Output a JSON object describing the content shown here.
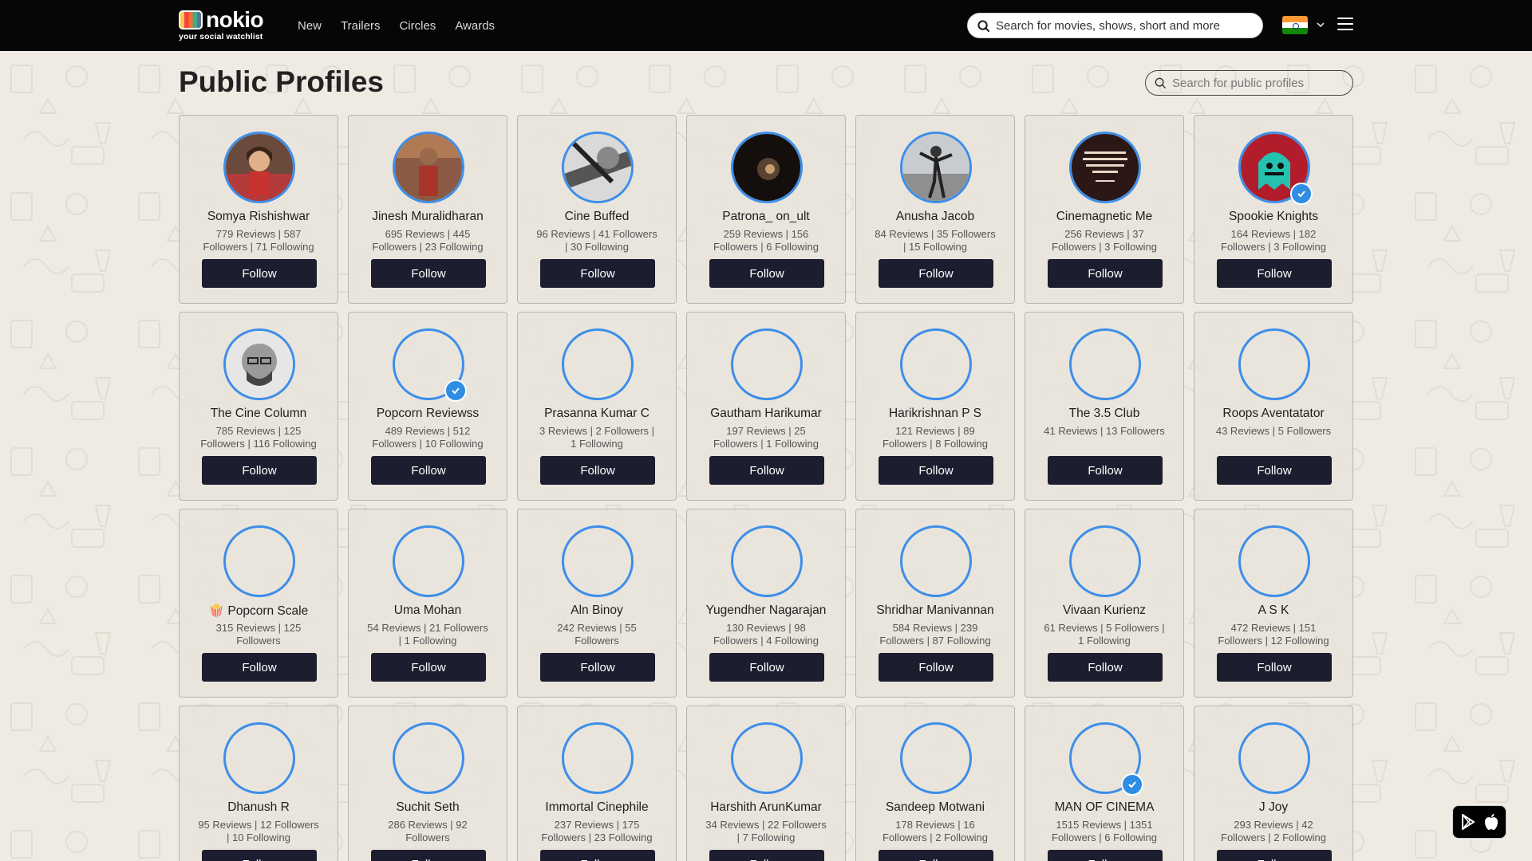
{
  "nav": {
    "logo_word": "nokio",
    "logo_tagline": "your social watchlist",
    "links": [
      "New",
      "Trailers",
      "Circles",
      "Awards"
    ],
    "search_placeholder": "Search for movies, shows, short and more"
  },
  "page": {
    "title": "Public Profiles",
    "search_placeholder": "Search for public profiles",
    "follow_label": "Follow"
  },
  "colors": {
    "nav_bg": "#060606",
    "page_bg": "#efebe3",
    "avatar_ring": "#3e8ee8",
    "follow_button_bg": "#1c1d2e",
    "verified_badge": "#2f8de4"
  },
  "profiles": [
    {
      "name": "Somya Rishishwar",
      "stats": "779 Reviews | 587 Followers | 71 Following",
      "avatar": "photo-woman-red",
      "verified": false
    },
    {
      "name": "Jinesh Muralidharan",
      "stats": "695 Reviews | 445 Followers | 23 Following",
      "avatar": "photo-man-red",
      "verified": false
    },
    {
      "name": "Cine Buffed",
      "stats": "96 Reviews | 41 Followers | 30 Following",
      "avatar": "photo-bw-film",
      "verified": false
    },
    {
      "name": "Patrona_ on_ult",
      "stats": "259 Reviews | 156 Followers | 6 Following",
      "avatar": "photo-dark",
      "verified": false
    },
    {
      "name": "Anusha Jacob",
      "stats": "84 Reviews | 35 Followers | 15 Following",
      "avatar": "photo-bw-pose",
      "verified": false
    },
    {
      "name": "Cinemagnetic Me",
      "stats": "256 Reviews | 37 Followers | 3 Following",
      "avatar": "quote-card",
      "verified": false
    },
    {
      "name": "Spookie Knights",
      "stats": "164 Reviews | 182 Followers | 3 Following",
      "avatar": "cartoon-ghost",
      "verified": true
    },
    {
      "name": "The Cine Column",
      "stats": "785 Reviews | 125 Followers | 116 Following",
      "avatar": "photo-man-bw",
      "verified": false
    },
    {
      "name": "Popcorn Reviewss",
      "stats": "489 Reviews | 512 Followers | 10 Following",
      "avatar": "empty",
      "verified": true
    },
    {
      "name": "Prasanna Kumar C",
      "stats": "3 Reviews | 2 Followers | 1 Following",
      "avatar": "empty",
      "verified": false
    },
    {
      "name": "Gautham Harikumar",
      "stats": "197 Reviews | 25 Followers | 1 Following",
      "avatar": "empty",
      "verified": false
    },
    {
      "name": "Harikrishnan P S",
      "stats": "121 Reviews | 89 Followers | 8 Following",
      "avatar": "empty",
      "verified": false
    },
    {
      "name": "The 3.5 Club",
      "stats": "41 Reviews | 13 Followers",
      "avatar": "empty",
      "verified": false
    },
    {
      "name": "Roops Aventatator",
      "stats": "43 Reviews | 5 Followers",
      "avatar": "empty",
      "verified": false
    },
    {
      "name": "🍿 Popcorn Scale",
      "stats": "315 Reviews | 125 Followers",
      "avatar": "empty",
      "verified": false
    },
    {
      "name": "Uma Mohan",
      "stats": "54 Reviews | 21 Followers | 1 Following",
      "avatar": "empty",
      "verified": false
    },
    {
      "name": "Aln Binoy",
      "stats": "242 Reviews | 55 Followers",
      "avatar": "empty",
      "verified": false
    },
    {
      "name": "Yugendher Nagarajan",
      "stats": "130 Reviews | 98 Followers | 4 Following",
      "avatar": "empty",
      "verified": false
    },
    {
      "name": "Shridhar Manivannan",
      "stats": "584 Reviews | 239 Followers | 87 Following",
      "avatar": "empty",
      "verified": false
    },
    {
      "name": "Vivaan Kurienz",
      "stats": "61 Reviews | 5 Followers | 1 Following",
      "avatar": "empty",
      "verified": false
    },
    {
      "name": "A S K",
      "stats": "472 Reviews | 151 Followers | 12 Following",
      "avatar": "empty",
      "verified": false
    },
    {
      "name": "Dhanush R",
      "stats": "95 Reviews | 12 Followers | 10 Following",
      "avatar": "empty",
      "verified": false
    },
    {
      "name": "Suchit Seth",
      "stats": "286 Reviews | 92 Followers",
      "avatar": "empty",
      "verified": false
    },
    {
      "name": "Immortal Cinephile",
      "stats": "237 Reviews | 175 Followers | 23 Following",
      "avatar": "empty",
      "verified": false
    },
    {
      "name": "Harshith ArunKumar",
      "stats": "34 Reviews | 22 Followers | 7 Following",
      "avatar": "empty",
      "verified": false
    },
    {
      "name": "Sandeep Motwani",
      "stats": "178 Reviews | 16 Followers | 2 Following",
      "avatar": "empty",
      "verified": false
    },
    {
      "name": "MAN OF CINEMA",
      "stats": "1515 Reviews | 1351 Followers | 6 Following",
      "avatar": "empty",
      "verified": true
    },
    {
      "name": "J Joy",
      "stats": "293 Reviews | 42 Followers | 2 Following",
      "avatar": "empty",
      "verified": false
    }
  ]
}
